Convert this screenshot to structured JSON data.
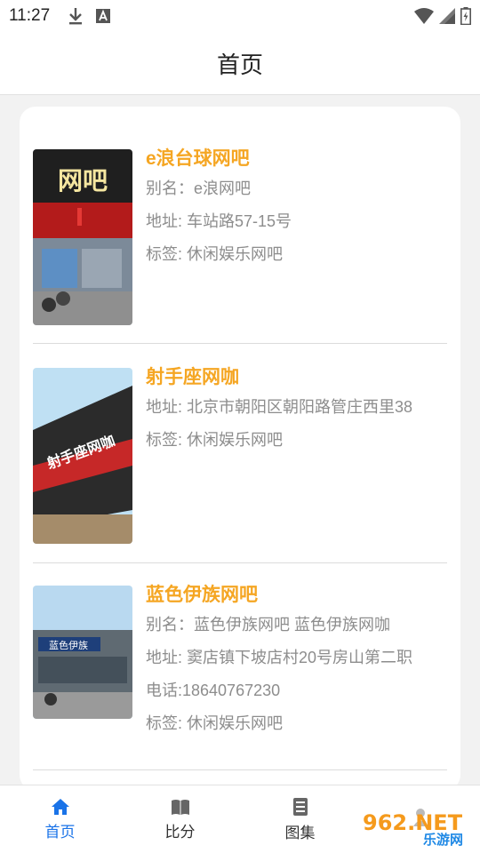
{
  "status_bar": {
    "time": "11:27"
  },
  "header": {
    "title": "首页"
  },
  "list": [
    {
      "name": "e浪台球网吧",
      "lines": [
        "别名：e浪网吧",
        "地址: 车站路57-15号",
        "标签: 休闲娱乐网吧"
      ],
      "photo_text": "网吧"
    },
    {
      "name": "射手座网咖",
      "lines": [
        "地址: 北京市朝阳区朝阳路管庄西里38",
        "标签: 休闲娱乐网吧"
      ],
      "photo_text": "射手座网咖"
    },
    {
      "name": "蓝色伊族网吧",
      "lines": [
        "别名：蓝色伊族网吧 蓝色伊族网咖",
        "地址: 窦店镇下坡店村20号房山第二职",
        "电话:18640767230",
        "标签: 休闲娱乐网吧"
      ],
      "photo_text": "蓝色伊族"
    }
  ],
  "bottom_nav": [
    {
      "label": "首页",
      "icon": "home-icon",
      "active": true
    },
    {
      "label": "比分",
      "icon": "book-icon",
      "active": false
    },
    {
      "label": "图集",
      "icon": "document-icon",
      "active": false
    },
    {
      "label": "",
      "icon": "person-icon",
      "active": false
    }
  ],
  "watermark": {
    "top_text": "962.NET",
    "bottom_text": "乐游网"
  },
  "colors": {
    "accent_orange": "#f5a623",
    "active_blue": "#1a73e8",
    "text_gray": "#8d8d8d"
  }
}
